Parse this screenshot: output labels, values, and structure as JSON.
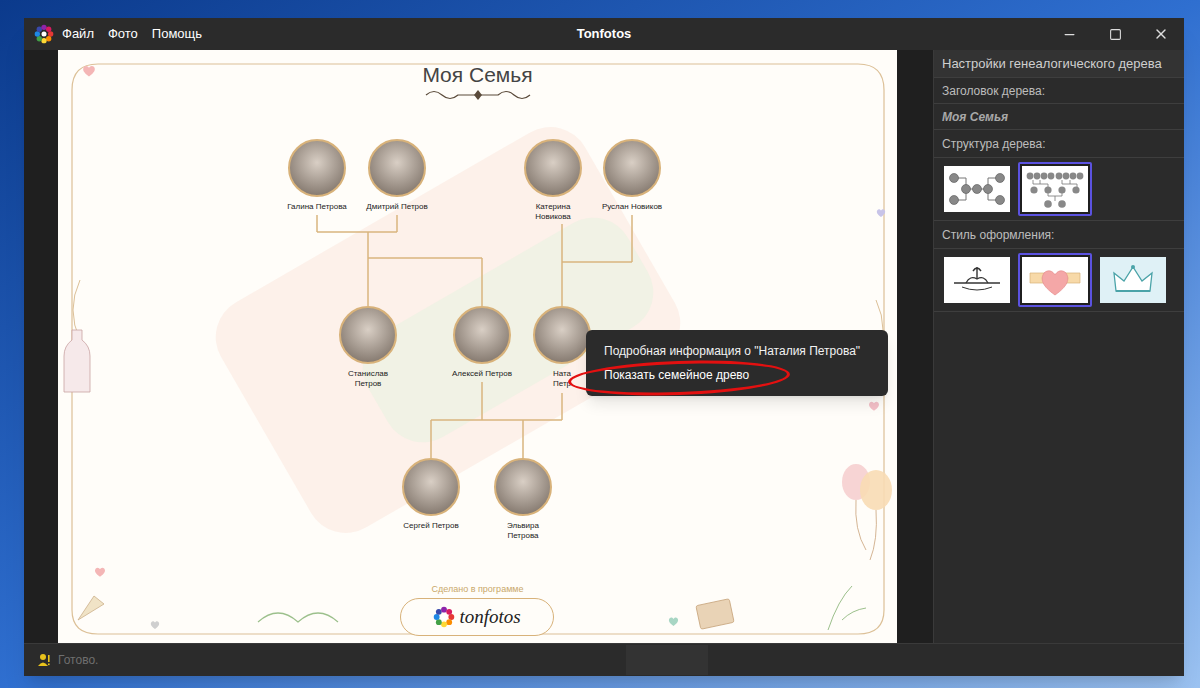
{
  "window": {
    "title": "Tonfotos",
    "menu": [
      "Файл",
      "Фото",
      "Помощь"
    ]
  },
  "tree": {
    "title": "Моя Семья",
    "people": [
      {
        "lines": [
          "Галина Петрова"
        ]
      },
      {
        "lines": [
          "Дмитрий Петров"
        ]
      },
      {
        "lines": [
          "Катерина",
          "Новикова"
        ]
      },
      {
        "lines": [
          "Руслан Новиков"
        ]
      },
      {
        "lines": [
          "Станислав",
          "Петров"
        ]
      },
      {
        "lines": [
          "Алексей Петров"
        ]
      },
      {
        "lines": [
          "Ната",
          "Петр"
        ]
      },
      {
        "lines": [
          "Сергей Петров"
        ]
      },
      {
        "lines": [
          "Эльвира",
          "Петрова"
        ]
      }
    ]
  },
  "context_menu": {
    "items": [
      {
        "label": "Подробная информация о \"Наталия Петрова\"",
        "highlighted": false
      },
      {
        "label": "Показать семейное древо",
        "highlighted": true
      }
    ]
  },
  "footer": {
    "caption": "Сделано в программе",
    "logo": "tonfotos"
  },
  "panel": {
    "title": "Настройки генеалогического дерева",
    "title_label": "Заголовок дерева:",
    "title_value": "Моя Семья",
    "structure_label": "Структура дерева:",
    "structures": [
      {
        "kind": "horizontal",
        "selected": false
      },
      {
        "kind": "vertical",
        "selected": true
      }
    ],
    "style_label": "Стиль оформления:",
    "styles": [
      {
        "kind": "classic",
        "selected": false
      },
      {
        "kind": "hearts",
        "selected": true
      },
      {
        "kind": "crown",
        "selected": false
      }
    ]
  },
  "status_bar": {
    "text": "Готово."
  }
}
